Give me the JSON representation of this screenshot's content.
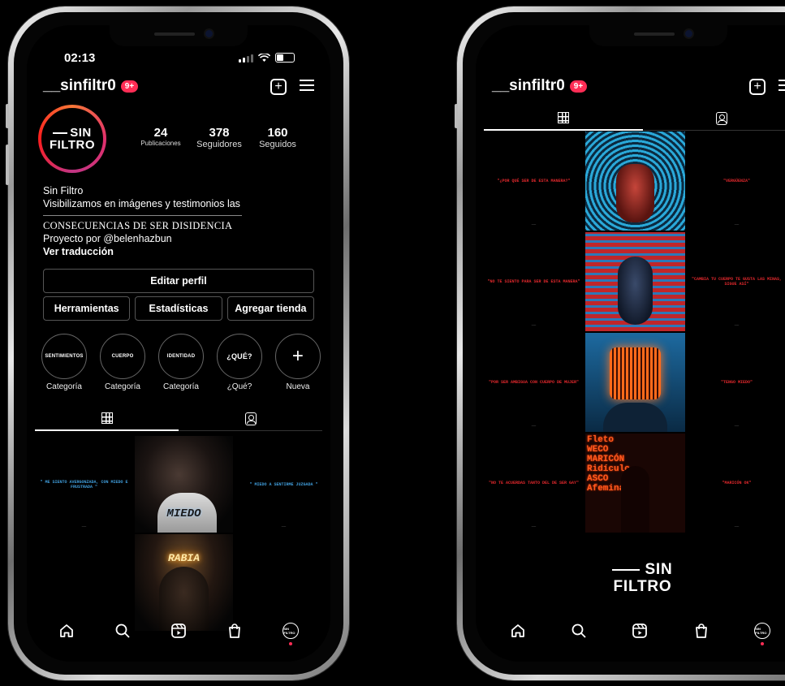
{
  "left": {
    "status": {
      "time": "02:13"
    },
    "header": {
      "username": "__sinfiltr0",
      "notif_badge": "9+"
    },
    "avatar": {
      "line1": "SIN",
      "line2": "FILTRO"
    },
    "stats": [
      {
        "value": "24",
        "label": "Publicaciones"
      },
      {
        "value": "378",
        "label": "Seguidores"
      },
      {
        "value": "160",
        "label": "Seguidos"
      }
    ],
    "bio": {
      "name": "Sin Filtro",
      "line1": "Visibilizamos en imágenes y testimonios las",
      "line2": "CONSECUENCIAS DE SER DISIDENCIA",
      "line3": "Proyecto por @belenhazbun",
      "translate": "Ver traducción"
    },
    "buttons": {
      "edit": "Editar perfil",
      "tools": "Herramientas",
      "stats": "Estadísticas",
      "shop": "Agregar tienda"
    },
    "highlights": [
      {
        "circle": "SENTIMIENTOS",
        "label": "Categoría"
      },
      {
        "circle": "CUERPO",
        "label": "Categoría"
      },
      {
        "circle": "IDENTIDAD",
        "label": "Categoría"
      },
      {
        "circle": "¿QUÉ?",
        "label": "¿Qué?"
      },
      {
        "circle": "+",
        "label": "Nueva"
      }
    ],
    "posts": {
      "card1": "\" ME SIENTO AVERGONZADA, CON MIEDO E FRUSTRADA \"",
      "photo1_word": "MIEDO",
      "card2": "\" MIEDO A SENTIRME JUZGADA \"",
      "photo2_word": "RABIA"
    },
    "avatar_nav": "SIN FILTRO"
  },
  "right": {
    "header": {
      "username": "__sinfiltr0",
      "notif_badge": "9+"
    },
    "cards": [
      {
        "quote": "\"¿POR QUÉ SER DE ESTA MANERA?\""
      },
      {
        "quote": "\"VERGÜENZA\""
      },
      {
        "quote": "\"NO TE SIENTO PARA SER DE ESTA MANERA\""
      },
      {
        "quote": "\"CAMBIA TU CUERPO TE GUSTA LAS MINAS, SIGUE ASÍ\""
      },
      {
        "quote": "\"POR SER AMBIGUA CON CUERPO DE MUJER\""
      },
      {
        "quote": "\"TENGO MIEDO\""
      },
      {
        "quote": "\"NO TE ACUERDAS TANTO DEL DE SER GAY\""
      },
      {
        "quote": "\"MARICÓN OK\""
      }
    ],
    "poster_words": [
      "Fleto",
      "WECO",
      "MARICÓN",
      "Ridículo",
      "ASCO",
      "Afeminado"
    ],
    "logo": {
      "line1": "SIN",
      "line2": "FILTRO"
    }
  },
  "colors": {
    "accent_red": "#ff2d55",
    "quote_blue": "#3f9bd8",
    "quote_red": "#e0282c"
  }
}
